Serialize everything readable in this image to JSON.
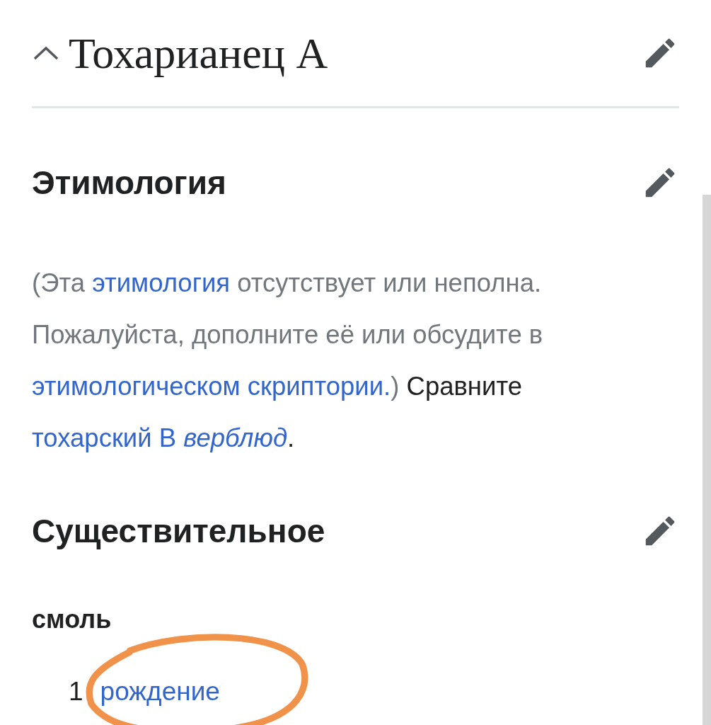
{
  "page_section": {
    "title": "Тохарианец A",
    "expanded": true
  },
  "etymology": {
    "heading": "Этимология",
    "text": [
      {
        "kind": "note",
        "text": "(Эта "
      },
      {
        "kind": "link",
        "text": "этимология"
      },
      {
        "kind": "note",
        "text": " отсутствует или неполна. Пожалуйста, дополните её или обсудите в "
      },
      {
        "kind": "link",
        "text": "этимологическом скриптории."
      },
      {
        "kind": "note",
        "text": ")"
      },
      {
        "kind": "plain",
        "text": " Сравните "
      },
      {
        "kind": "link",
        "text": "тохарский B *верблюд*"
      },
      {
        "kind": "plain",
        "text": "."
      }
    ]
  },
  "noun": {
    "heading": "Существительное",
    "headword": "смоль",
    "senses": [
      {
        "number": "1",
        "text": "рождение",
        "circled": true
      }
    ]
  }
}
